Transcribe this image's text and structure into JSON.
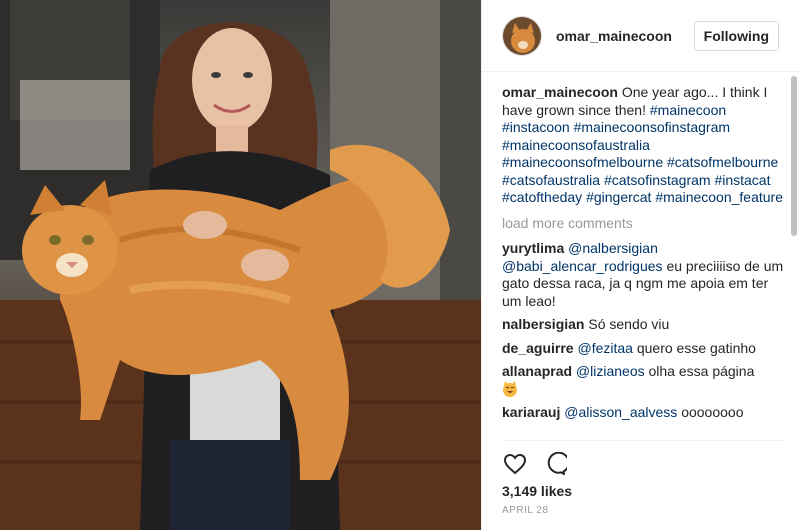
{
  "post": {
    "author": "omar_mainecoon",
    "follow_label": "Following",
    "caption_text": "One year ago... I think I have grown since then!",
    "hashtags": [
      "#mainecoon",
      "#instacoon",
      "#mainecoonsofinstagram",
      "#mainecoonsofaustralia",
      "#mainecoonsofmelbourne",
      "#catsofmelbourne",
      "#catsofaustralia",
      "#catsofinstagram",
      "#instacat",
      "#catoftheday",
      "#gingercat",
      "#mainecoon_feature"
    ],
    "load_more_label": "load more comments",
    "likes": "3,149 likes",
    "date": "APRIL 28"
  },
  "comments": [
    {
      "user": "yurytlima",
      "mentions": [
        "@nalbersigian",
        "@babi_alencar_rodrigues"
      ],
      "text": "eu preciiiiso de um gato dessa raca, ja q ngm me apoia em ter um leao!"
    },
    {
      "user": "nalbersigian",
      "mentions": [],
      "text": "Só sendo viu"
    },
    {
      "user": "de_aguirre",
      "mentions": [
        "@fezitaa"
      ],
      "text": "quero esse gatinho"
    },
    {
      "user": "allanaprad",
      "mentions": [
        "@lizianeos"
      ],
      "text": "olha essa página"
    },
    {
      "user": "kariarauj",
      "mentions": [
        "@alisson_aalvess"
      ],
      "text": "oooooooo"
    }
  ],
  "icons": {
    "like": "heart-icon",
    "comment": "comment-bubble-icon",
    "emoji": "smiling-cat-emoji"
  },
  "colors": {
    "hashtag": "#003569",
    "muted": "#999999",
    "text": "#262626",
    "border": "#dbdbdb"
  }
}
